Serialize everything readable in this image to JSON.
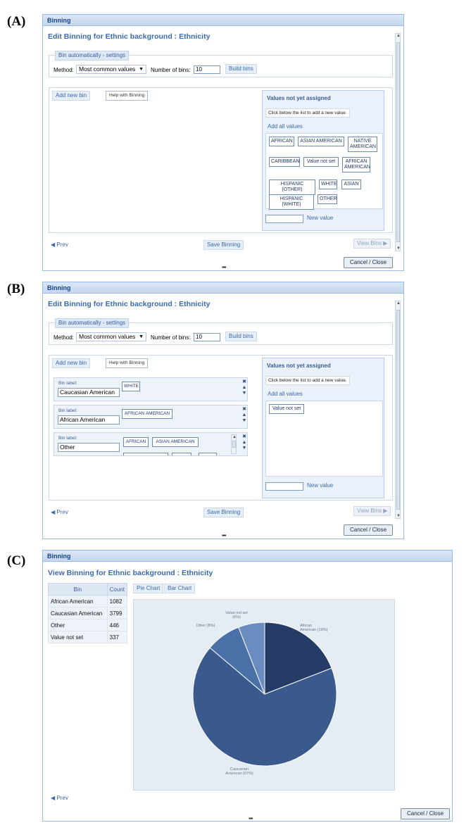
{
  "labels": {
    "a": "(A)",
    "b": "(B)",
    "c": "(C)"
  },
  "window_title": "Binning",
  "edit_heading": "Edit Binning for Ethnic background : Ethnicity",
  "view_heading": "View Binning for Ethnic background : Ethnicity",
  "settings": {
    "legend": "Bin automatically - settings",
    "method_label": "Method:",
    "method_value": "Most common values",
    "bins_label": "Number of bins:",
    "bins_value": "10",
    "build_button": "Build bins"
  },
  "add_new_bin": "Add new bin",
  "help_button": "Help with Binning",
  "values_panel": {
    "title": "Values not yet assigned",
    "hint": "Click below the list to add a new value.",
    "add_all": "Add all values",
    "new_value_button": "New value"
  },
  "panel_a_values": [
    "AFRICAN",
    "ASIAN AMERICAN",
    "NATIVE AMERICAN",
    "CARIBBEAN",
    "Value not set",
    "AFRICAN AMERICAN",
    "HISPANIC (OTHER)",
    "WHITE",
    "ASIAN",
    "HISPANIC (WHITE)",
    "OTHER"
  ],
  "panel_b_values": [
    "Value not set"
  ],
  "bins": [
    {
      "caption": "Bin label:",
      "name": "Caucasian American",
      "values": [
        "WHITE"
      ]
    },
    {
      "caption": "Bin label:",
      "name": "African American",
      "values": [
        "AFRICAN AMERICAN"
      ]
    },
    {
      "caption": "Bin label:",
      "name": "Other",
      "values": [
        "AFRICAN",
        "ASIAN AMERICAN"
      ]
    }
  ],
  "nav": {
    "prev": "Prev",
    "save": "Save Binning",
    "view_bins": "View Bins",
    "cancel_close": "Cancel / Close"
  },
  "view": {
    "table_headers": [
      "Bin",
      "Count"
    ],
    "rows": [
      {
        "bin": "African American",
        "count": "1082"
      },
      {
        "bin": "Caucasian American",
        "count": "3799"
      },
      {
        "bin": "Other",
        "count": "446"
      },
      {
        "bin": "Value not set",
        "count": "337"
      }
    ],
    "pie_button": "Pie Chart",
    "bar_button": "Bar Chart"
  },
  "chart_data": {
    "type": "pie",
    "categories": [
      "African American",
      "Caucasian American",
      "Other",
      "Value not set"
    ],
    "values": [
      1082,
      3799,
      446,
      337
    ],
    "slice_labels": [
      "African American (19%)",
      "Caucasian American (67%)",
      "Other (8%)",
      "Value not set (6%)"
    ],
    "colors": [
      "#253d66",
      "#3a5a8e",
      "#4a70a8",
      "#6a8cc0"
    ],
    "title": "",
    "legend": "none"
  },
  "colors": {
    "title_text": "#15428b",
    "heading": "#3a6ab0",
    "border": "#99bbe8"
  }
}
